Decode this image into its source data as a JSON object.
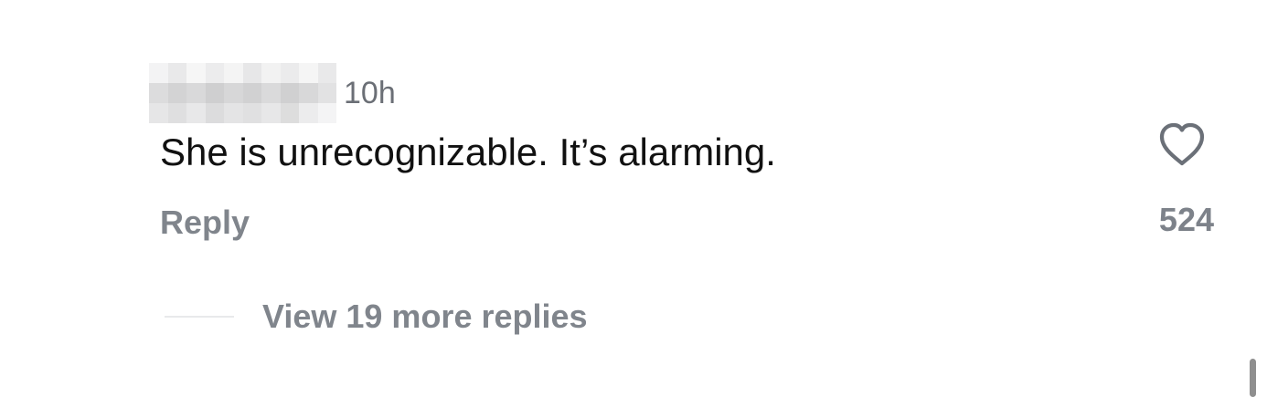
{
  "comment": {
    "username": "",
    "timestamp": "10h",
    "text": "She is unrecognizable. It’s alarming.",
    "reply_label": "Reply",
    "like_icon": "heart-outline-icon",
    "like_count": "524",
    "view_replies_label": "View 19 more replies"
  },
  "colors": {
    "text_primary": "#111111",
    "text_secondary": "#80858c",
    "icon": "#6b7078",
    "divider": "#e8e9eb"
  }
}
